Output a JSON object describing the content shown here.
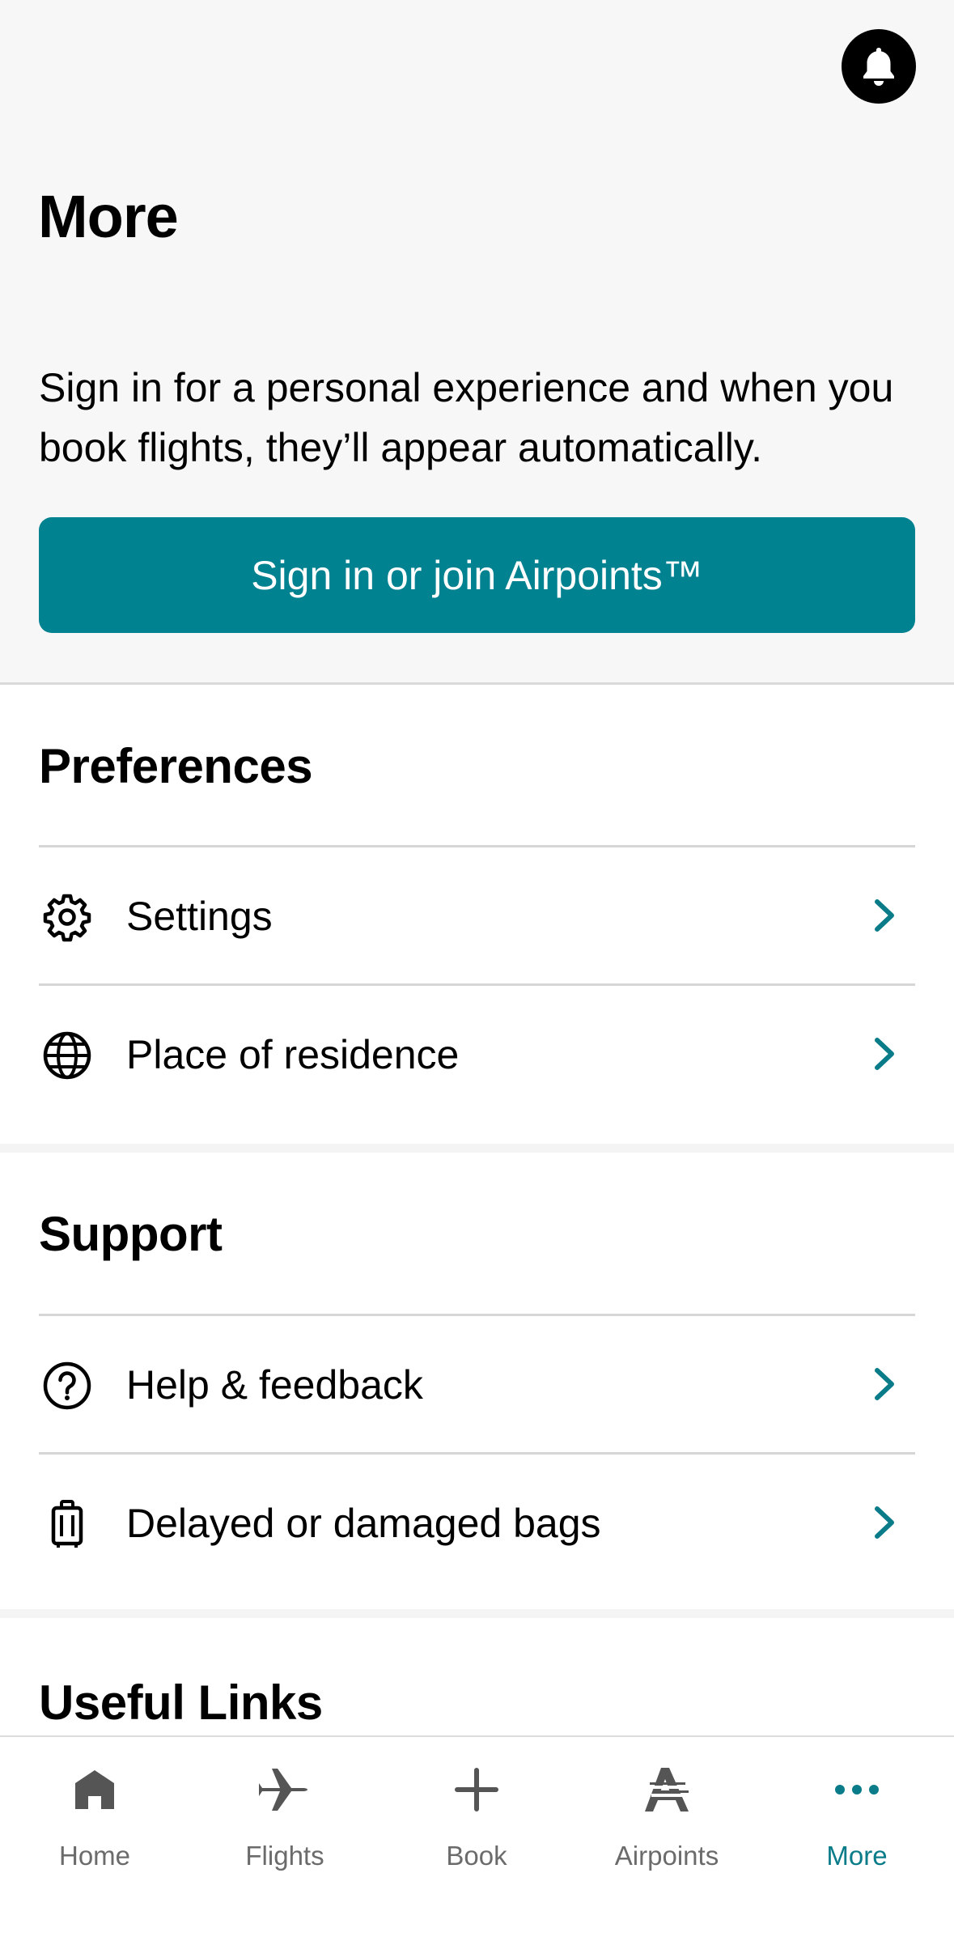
{
  "header": {
    "title": "More",
    "notification_icon": "bell-icon"
  },
  "signin": {
    "prompt": "Sign in for a personal experience and when you book flights, they’ll appear automatically.",
    "button_label": "Sign in or join Airpoints™"
  },
  "preferences": {
    "title": "Preferences",
    "items": [
      {
        "label": "Settings",
        "icon": "gear-icon"
      },
      {
        "label": "Place of residence",
        "icon": "globe-icon"
      }
    ]
  },
  "support": {
    "title": "Support",
    "items": [
      {
        "label": "Help & feedback",
        "icon": "help-circle-icon"
      },
      {
        "label": "Delayed or damaged bags",
        "icon": "luggage-icon"
      }
    ]
  },
  "useful_links": {
    "title": "Useful Links"
  },
  "tabbar": {
    "items": [
      {
        "label": "Home",
        "icon": "home-icon",
        "active": false
      },
      {
        "label": "Flights",
        "icon": "plane-icon",
        "active": false
      },
      {
        "label": "Book",
        "icon": "plus-icon",
        "active": false
      },
      {
        "label": "Airpoints",
        "icon": "airpoints-icon",
        "active": false
      },
      {
        "label": "More",
        "icon": "more-dots-icon",
        "active": true
      }
    ]
  },
  "colors": {
    "accent": "#008290",
    "active_tab": "#0a7c89",
    "inactive_tab": "#6b6b6b"
  }
}
